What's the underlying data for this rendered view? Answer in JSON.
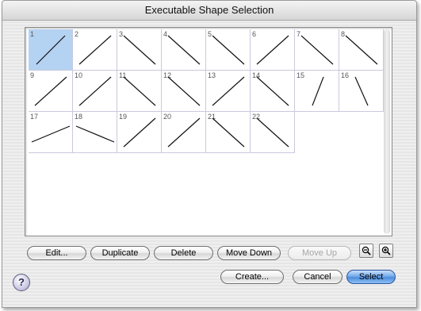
{
  "window": {
    "title": "Executable Shape Selection"
  },
  "shapes": [
    {
      "id": "1",
      "selected": true
    },
    {
      "id": "2"
    },
    {
      "id": "3"
    },
    {
      "id": "4"
    },
    {
      "id": "5"
    },
    {
      "id": "6"
    },
    {
      "id": "7"
    },
    {
      "id": "8"
    },
    {
      "id": "9"
    },
    {
      "id": "10"
    },
    {
      "id": "11"
    },
    {
      "id": "12"
    },
    {
      "id": "13"
    },
    {
      "id": "14"
    },
    {
      "id": "15"
    },
    {
      "id": "16"
    },
    {
      "id": "17"
    },
    {
      "id": "18"
    },
    {
      "id": "19"
    },
    {
      "id": "20"
    },
    {
      "id": "21"
    },
    {
      "id": "22"
    }
  ],
  "toolbar": {
    "edit": "Edit...",
    "duplicate": "Duplicate",
    "delete": "Delete",
    "move_down": "Move Down",
    "move_up": "Move Up"
  },
  "footer": {
    "create": "Create...",
    "cancel": "Cancel",
    "select": "Select",
    "help": "?"
  },
  "colors": {
    "selection": "#b4d2f2",
    "primary_button": "#4d8ddd"
  }
}
